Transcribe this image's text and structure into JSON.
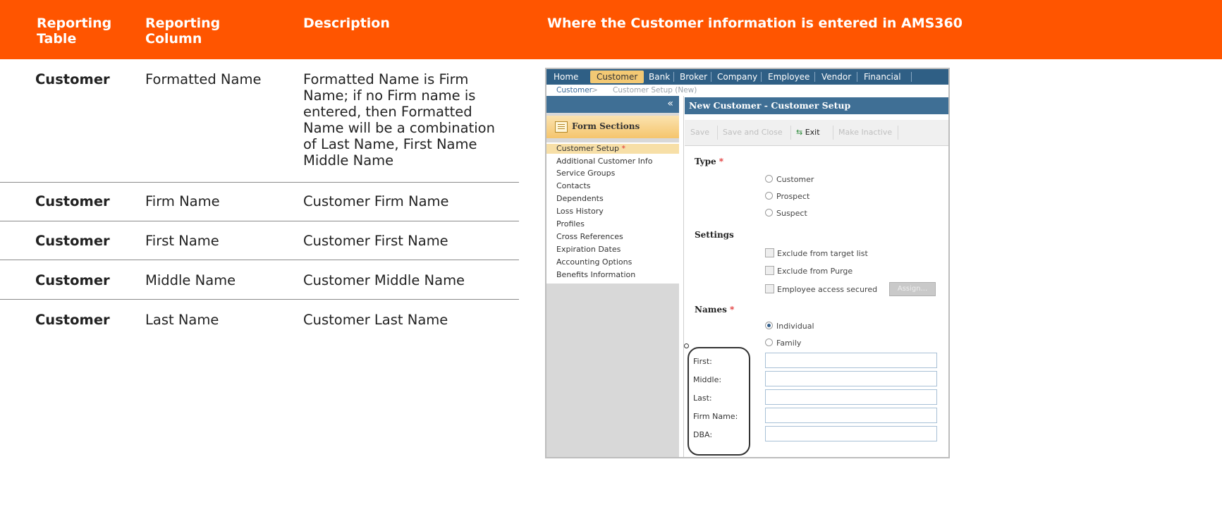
{
  "header": {
    "reporting_table": "Reporting Table",
    "reporting_column": "Reporting Column",
    "description": "Description",
    "where_entered": "Where the Customer information is entered in AMS360"
  },
  "rows": [
    {
      "table": "Customer",
      "column": "Formatted Name",
      "description_lines": [
        "Formatted Name is Firm",
        "Name; if no Firm name is",
        "entered, then Formatted",
        "Name will be a combination",
        "of Last Name, First Name",
        "Middle Name"
      ]
    },
    {
      "table": "Customer",
      "column": "Firm Name",
      "description": "Customer Firm Name"
    },
    {
      "table": "Customer",
      "column": "First Name",
      "description": "Customer First Name"
    },
    {
      "table": "Customer",
      "column": "Middle Name",
      "description": "Customer Middle Name"
    },
    {
      "table": "Customer",
      "column": "Last Name",
      "description": "Customer Last Name"
    }
  ],
  "screenshot": {
    "nav": [
      "Home",
      "Customer",
      "Bank",
      "Broker",
      "Company",
      "Employee",
      "Vendor",
      "Financial"
    ],
    "breadcrumb": [
      "Customer",
      ">",
      "Customer Setup (New)"
    ],
    "collapse_glyph": "«",
    "form_sections_label": "Form Sections",
    "sections": [
      "Customer Setup",
      "Additional Customer Info",
      "Service Groups",
      "Contacts",
      "Dependents",
      "Loss History",
      "Profiles",
      "Cross References",
      "Expiration Dates",
      "Accounting Options",
      "Benefits Information"
    ],
    "required_mark": "*",
    "title": "New Customer - Customer Setup",
    "toolbar": [
      "Save",
      "Save and Close",
      "Exit",
      "Make Inactive"
    ],
    "type_label": "Type",
    "type_options": [
      "Customer",
      "Prospect",
      "Suspect"
    ],
    "settings_label": "Settings",
    "settings_options": [
      "Exclude from target list",
      "Exclude from Purge",
      "Employee access secured"
    ],
    "assign_label": "Assign...",
    "names_label": "Names",
    "names_options": [
      "Individual",
      "Family"
    ],
    "fields": [
      "First:",
      "Middle:",
      "Last:",
      "Firm Name:",
      "DBA:"
    ],
    "colors": {
      "header_orange": "#ff5500",
      "nav_blue": "#2f5f85",
      "tab_gold": "#f3c974"
    }
  }
}
